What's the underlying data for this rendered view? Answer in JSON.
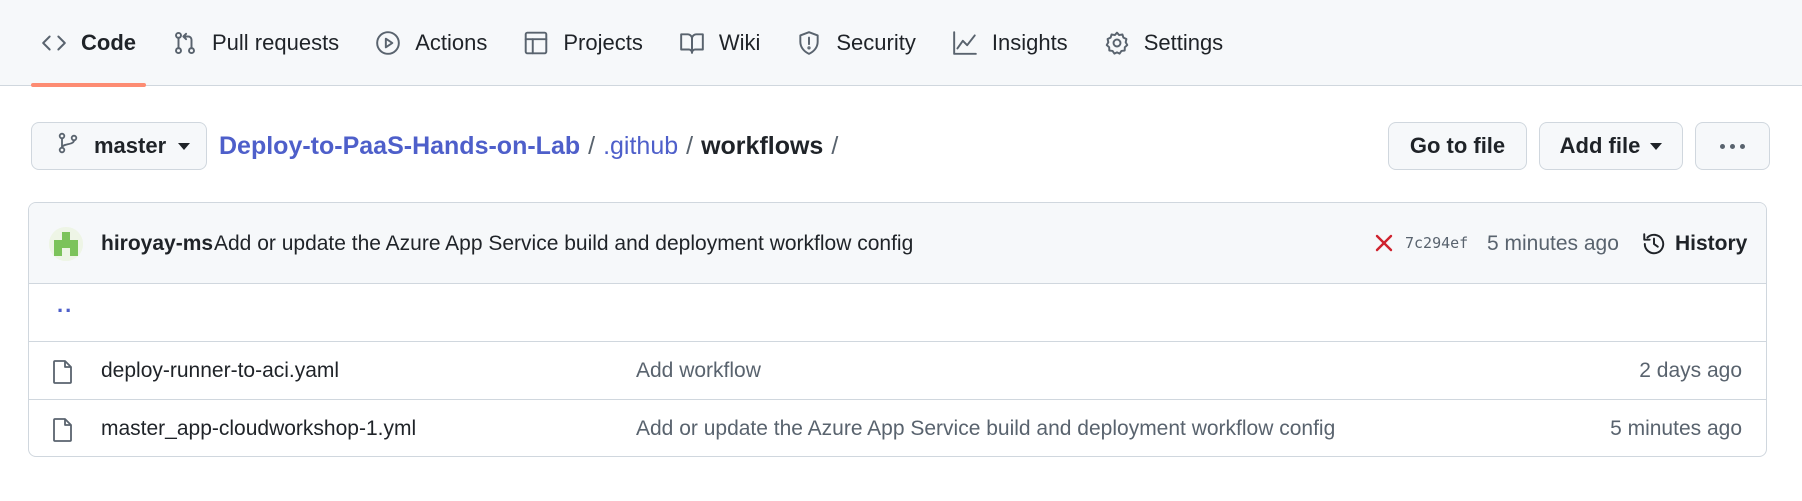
{
  "nav": {
    "tabs": [
      {
        "label": "Code",
        "icon": "code-icon",
        "selected": true
      },
      {
        "label": "Pull requests",
        "icon": "pull-request-icon"
      },
      {
        "label": "Actions",
        "icon": "play-icon"
      },
      {
        "label": "Projects",
        "icon": "table-icon"
      },
      {
        "label": "Wiki",
        "icon": "book-icon"
      },
      {
        "label": "Security",
        "icon": "shield-icon"
      },
      {
        "label": "Insights",
        "icon": "graph-icon"
      },
      {
        "label": "Settings",
        "icon": "gear-icon"
      }
    ],
    "selected_underline_color": "#fd8c73"
  },
  "toolbar": {
    "branch": "master",
    "breadcrumb": {
      "repo": "Deploy-to-PaaS-Hands-on-Lab",
      "folder": ".github",
      "current": "workflows",
      "separator": "/"
    },
    "go_to_file": "Go to file",
    "add_file": "Add file"
  },
  "latest_commit": {
    "author": "hiroyay-ms",
    "message": "Add or update the Azure App Service build and deployment workflow config",
    "status": "failure",
    "status_color": "#cf222e",
    "sha": "7c294ef",
    "time": "5 minutes ago",
    "history_label": "History"
  },
  "parent_dir": "..",
  "files": [
    {
      "name": "deploy-runner-to-aci.yaml",
      "message": "Add workflow",
      "time": "2 days ago",
      "icon": "file-icon"
    },
    {
      "name": "master_app-cloudworkshop-1.yml",
      "message": "Add or update the Azure App Service build and deployment workflow config",
      "time": "5 minutes ago",
      "icon": "file-icon"
    }
  ],
  "colors": {
    "link": "#4e5fca",
    "muted": "#59636e",
    "border": "#d0d7de",
    "header_bg": "#f6f8fa"
  }
}
